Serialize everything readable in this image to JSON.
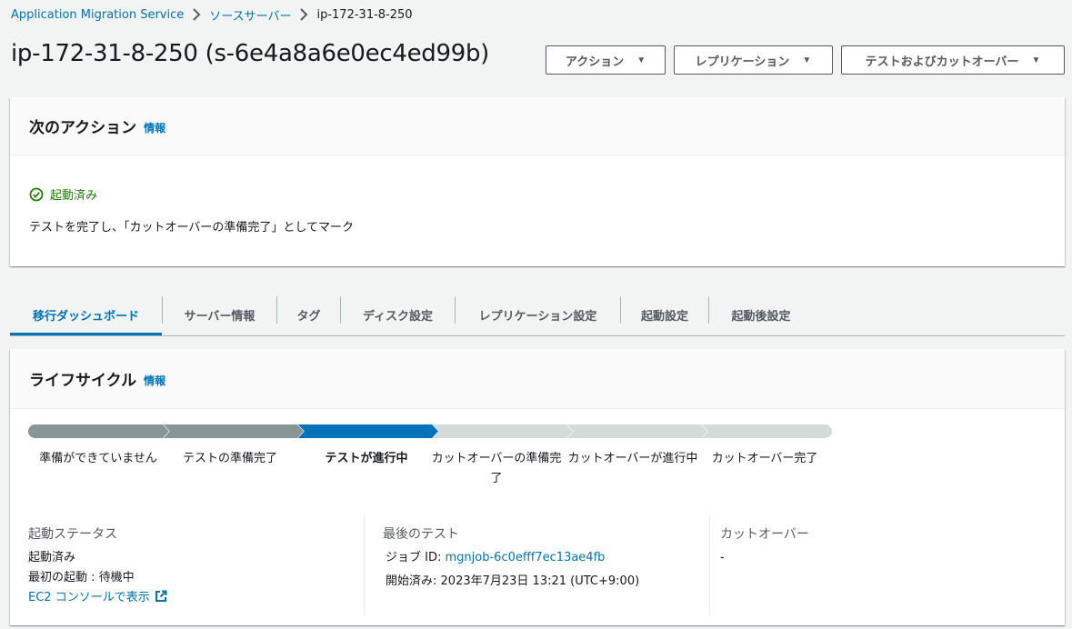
{
  "breadcrumb": {
    "items": [
      "Application Migration Service",
      "ソースサーバー"
    ],
    "current": "ip-172-31-8-250"
  },
  "header": {
    "title": "ip-172-31-8-250 (s-6e4a8a6e0ec4ed99b)",
    "actions": [
      "アクション",
      "レプリケーション",
      "テストおよびカットオーバー"
    ]
  },
  "next_action": {
    "title": "次のアクション",
    "info": "情報",
    "status": "起動済み",
    "status_color": "#1d8102",
    "description": "テストを完了し、「カットオーバーの準備完了」としてマーク"
  },
  "tabs": [
    "移行ダッシュボード",
    "サーバー情報",
    "タグ",
    "ディスク設定",
    "レプリケーション設定",
    "起動設定",
    "起動後設定"
  ],
  "active_tab": "移行ダッシュボード",
  "lifecycle": {
    "title": "ライフサイクル",
    "info": "情報",
    "stages": [
      {
        "label": "準備ができていません",
        "state": "complete"
      },
      {
        "label": "テストの準備完了",
        "state": "complete"
      },
      {
        "label": "テストが進行中",
        "state": "current"
      },
      {
        "label": "カットオーバーの準備完了",
        "state": "pending"
      },
      {
        "label": "カットオーバーが進行中",
        "state": "pending"
      },
      {
        "label": "カットオーバー完了",
        "state": "pending"
      }
    ],
    "colors": {
      "complete": "#879596",
      "current": "#0073bb",
      "pending": "#d5dbdb"
    },
    "launch_status": {
      "title": "起動ステータス",
      "status": "起動済み",
      "first_launch": "最初の起動 : 待機中",
      "console_link": "EC2 コンソールで表示"
    },
    "last_test": {
      "title": "最後のテスト",
      "job_label": "ジョブ ID:",
      "job_id": "mgnjob-6c0efff7ec13ae4fb",
      "started_label": "開始済み:",
      "started_value": "2023年7月23日 13:21 (UTC+9:00)"
    },
    "cutover": {
      "title": "カットオーバー",
      "value": "-"
    }
  }
}
